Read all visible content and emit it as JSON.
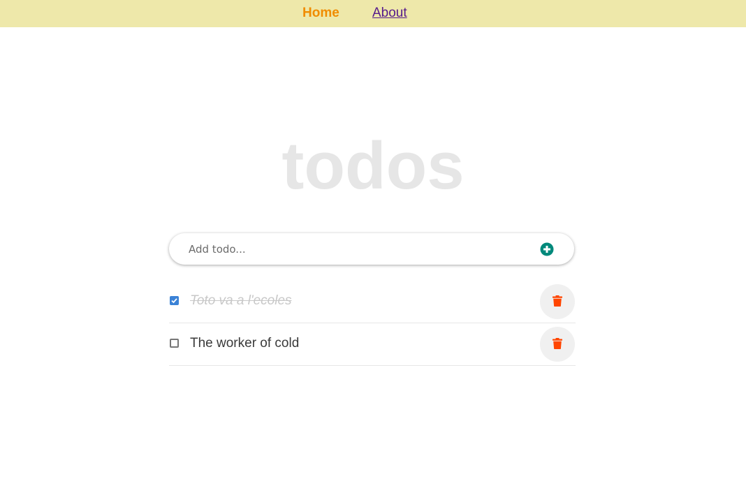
{
  "nav": {
    "home_label": "Home",
    "about_label": "About"
  },
  "title": "todos",
  "add_todo": {
    "placeholder": "Add todo...",
    "value": "",
    "add_icon": "plus-circle-icon"
  },
  "todos": [
    {
      "text": "Toto va a l'ecoles",
      "completed": true,
      "delete_icon": "trash-icon"
    },
    {
      "text": "The worker of cold",
      "completed": false,
      "delete_icon": "trash-icon"
    }
  ],
  "colors": {
    "navbar_bg": "#eee8aa",
    "home_link": "#f08c00",
    "about_link": "#551a8b",
    "title": "#e6e6e6",
    "add_icon": "#00897b",
    "delete_icon": "#ff4500",
    "checkbox_checked": "#3b82d6"
  }
}
